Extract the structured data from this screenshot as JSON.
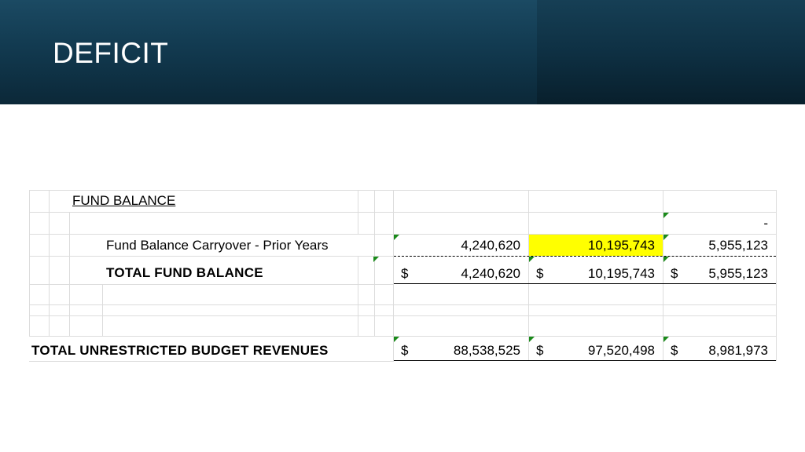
{
  "slide": {
    "title": "DEFICIT"
  },
  "table": {
    "section_heading": "FUND BALANCE",
    "dash_value": "-",
    "carryover": {
      "label": "Fund Balance Carryover - Prior Years",
      "col1": "4,240,620",
      "col2": "10,195,743",
      "col3": "5,955,123"
    },
    "total_fund_balance": {
      "label": "TOTAL FUND BALANCE",
      "currency": "$",
      "col1": "4,240,620",
      "col2": "10,195,743",
      "col3": "5,955,123"
    },
    "total_unrestricted": {
      "label": "TOTAL UNRESTRICTED BUDGET REVENUES",
      "currency": "$",
      "col1": "88,538,525",
      "col2": "97,520,498",
      "col3": "8,981,973"
    }
  },
  "colors": {
    "highlight": "#ffff00",
    "header_bg": "#123a50",
    "comment_marker": "#1a8a1a"
  }
}
